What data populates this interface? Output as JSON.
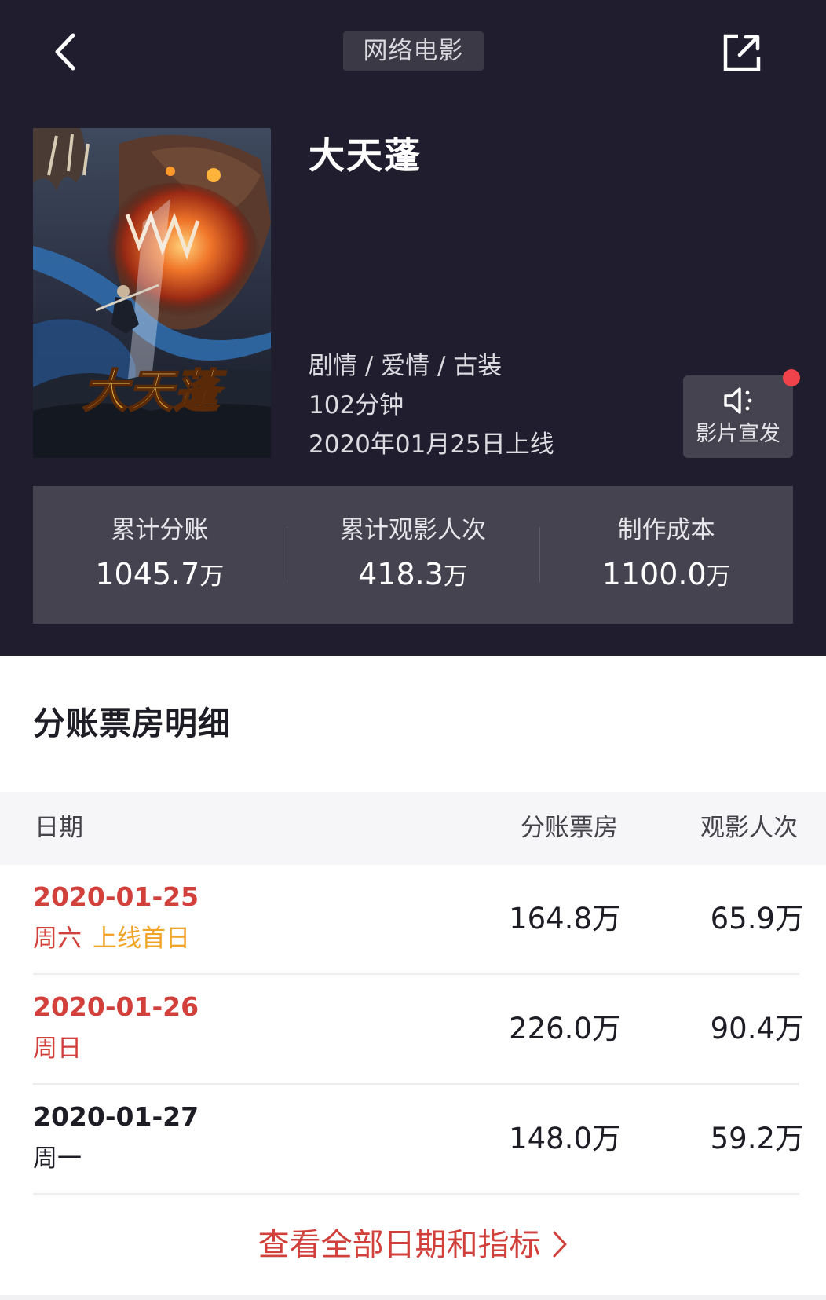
{
  "header": {
    "type_tag": "网络电影"
  },
  "movie": {
    "title": "大天蓬",
    "genres": "剧情 / 爱情 / 古装",
    "duration": "102分钟",
    "release": "2020年01月25日上线",
    "poster_title_art": "大天蓬"
  },
  "promo": {
    "label": "影片宣发",
    "icon": "speaker-icon"
  },
  "stats": [
    {
      "label": "累计分账",
      "value": "1045.7",
      "unit": "万"
    },
    {
      "label": "累计观影人次",
      "value": "418.3",
      "unit": "万"
    },
    {
      "label": "制作成本",
      "value": "1100.0",
      "unit": "万"
    }
  ],
  "detail": {
    "title": "分账票房明细",
    "columns": {
      "date": "日期",
      "box_office": "分账票房",
      "viewers": "观影人次"
    },
    "rows": [
      {
        "date": "2020-01-25",
        "weekday": "周六",
        "badge": "上线首日",
        "box_office": "164.8万",
        "viewers": "65.9万"
      },
      {
        "date": "2020-01-26",
        "weekday": "周日",
        "badge": "",
        "box_office": "226.0万",
        "viewers": "90.4万"
      },
      {
        "date": "2020-01-27",
        "weekday": "周一",
        "badge": "",
        "box_office": "148.0万",
        "viewers": "59.2万"
      }
    ],
    "view_all": "查看全部日期和指标"
  },
  "colors": {
    "header_bg": "#201d2f",
    "card_bg": "#45434f",
    "accent_red": "#d2403c",
    "badge_orange": "#f0a528",
    "notification_dot": "#f0424a"
  }
}
